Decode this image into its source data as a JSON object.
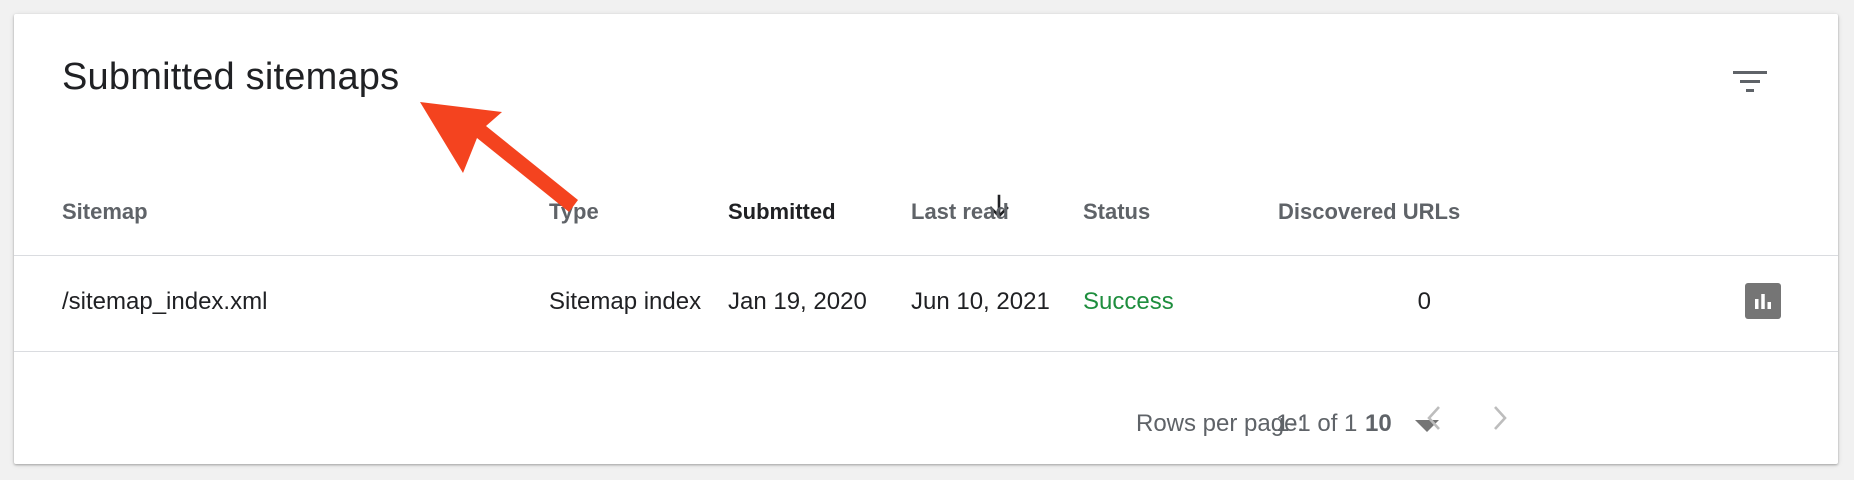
{
  "card": {
    "title": "Submitted sitemaps"
  },
  "table": {
    "columns": [
      "Sitemap",
      "Type",
      "Submitted",
      "Last read",
      "Status",
      "Discovered URLs"
    ],
    "sorted_column": "Submitted",
    "sort_direction": "descending",
    "rows": [
      {
        "sitemap": "/sitemap_index.xml",
        "type": "Sitemap index",
        "submitted": "Jan 19, 2020",
        "last_read": "Jun 10, 2021",
        "status": "Success",
        "discovered_urls": "0"
      }
    ]
  },
  "footer": {
    "rows_per_page_label": "Rows per page:",
    "rows_per_page_value": "10",
    "range": "1-1 of 1"
  },
  "icons": {
    "filter": "filter-icon",
    "sort": "arrow-down-icon",
    "chart": "bar-chart-icon",
    "caret": "caret-down-icon",
    "prev": "chevron-left-icon",
    "next": "chevron-right-icon"
  },
  "colors": {
    "success": "#1e8e3e",
    "annotation_arrow": "#f4431f",
    "chart_button": "#757575"
  }
}
